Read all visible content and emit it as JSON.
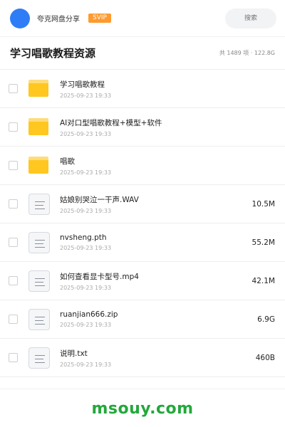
{
  "header": {
    "site_name": "夸克网盘分享",
    "badge": "SVIP",
    "search_placeholder": "搜索"
  },
  "title_bar": {
    "title": "学习唱歌教程资源",
    "summary": "共 1489 项 · 122.8G"
  },
  "files": [
    {
      "type": "folder",
      "name": "学习唱歌教程",
      "date": "2025-09-23 19:33",
      "size": ""
    },
    {
      "type": "folder",
      "name": "AI对口型唱歌教程+模型+软件",
      "date": "2025-09-23 19:33",
      "size": ""
    },
    {
      "type": "folder",
      "name": "唱歌",
      "date": "2025-09-23 19:33",
      "size": ""
    },
    {
      "type": "file",
      "name": "姑娘别哭泣一干声.WAV",
      "date": "2025-09-23 19:33",
      "size": "10.5M"
    },
    {
      "type": "file",
      "name": "nvsheng.pth",
      "date": "2025-09-23 19:33",
      "size": "55.2M"
    },
    {
      "type": "file",
      "name": "如何查看显卡型号.mp4",
      "date": "2025-09-23 19:33",
      "size": "42.1M"
    },
    {
      "type": "file",
      "name": "ruanjian666.zip",
      "date": "2025-09-23 19:33",
      "size": "6.9G"
    },
    {
      "type": "file",
      "name": "说明.txt",
      "date": "2025-09-23 19:33",
      "size": "460B"
    }
  ],
  "watermark": "msouy.com",
  "colors": {
    "accent": "#2f7df6",
    "badge": "#ff9a2e",
    "folder": "#ffc71f",
    "watermark": "#22a83a"
  }
}
